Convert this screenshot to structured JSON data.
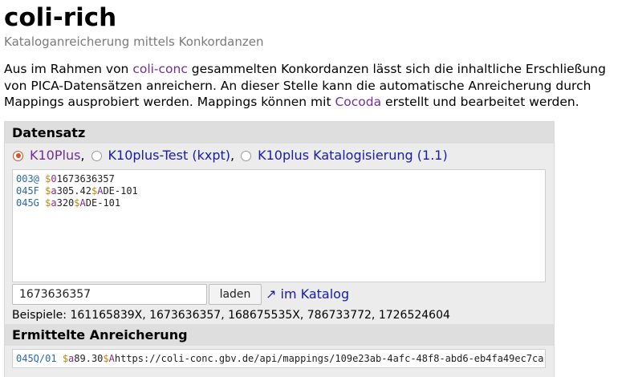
{
  "header": {
    "title": "coli-rich",
    "subtitle": "Kataloganreicherung mittels Konkordanzen"
  },
  "intro": {
    "text1": "Aus im Rahmen von ",
    "link1": "coli-conc",
    "text2": " gesammelten Konkordanzen lässt sich die inhaltliche Erschließung von PICA-Datensätzen anreichern. An dieser Stelle kann die automatische Anreicherung durch Mappings ausprobiert werden. Mappings können mit ",
    "link2": "Cocoda",
    "text3": " erstellt und bearbeitet werden."
  },
  "record_section": {
    "heading": "Datensatz",
    "sources": [
      {
        "label": "K10Plus",
        "selected": true
      },
      {
        "label": "K10plus-Test (kxpt)",
        "selected": false
      },
      {
        "label": "K10plus Katalogisierung (1.1)",
        "selected": false
      }
    ],
    "separator": ",",
    "pica_lines": [
      {
        "tag": "003@",
        "subfields": [
          {
            "code": "0",
            "value": "1673636357"
          }
        ]
      },
      {
        "tag": "045F",
        "subfields": [
          {
            "code": "a",
            "value": "305.42"
          },
          {
            "code": "A",
            "value": "DE-101"
          }
        ]
      },
      {
        "tag": "045G",
        "subfields": [
          {
            "code": "a",
            "value": "320"
          },
          {
            "code": "A",
            "value": "DE-101"
          }
        ]
      }
    ],
    "id_input_value": "1673636357",
    "load_button": "laden",
    "catalog_link_arrow": "↗",
    "catalog_link": "im Katalog",
    "examples_label": "Beispiele:",
    "examples": "161165839X, 1673636357, 168675535X, 786733772, 1726524604"
  },
  "result_section": {
    "heading": "Ermittelte Anreicherung",
    "tag": "045Q/01",
    "subfields": [
      {
        "code": "a",
        "value": "89.30"
      },
      {
        "code": "A",
        "value": "https://coli-conc.gbv.de/api/mappings/109e23ab-4afc-48f8-abd6-eb4fa49ec7ca"
      }
    ]
  },
  "colors": {
    "link": "#1a1aa6",
    "visited_link": "#6f2f93",
    "pica_tag": "#2b67a8",
    "pica_dollar": "#b8860b",
    "pica_code": "#7a2f8e",
    "radio_selected": "#d3552a"
  }
}
